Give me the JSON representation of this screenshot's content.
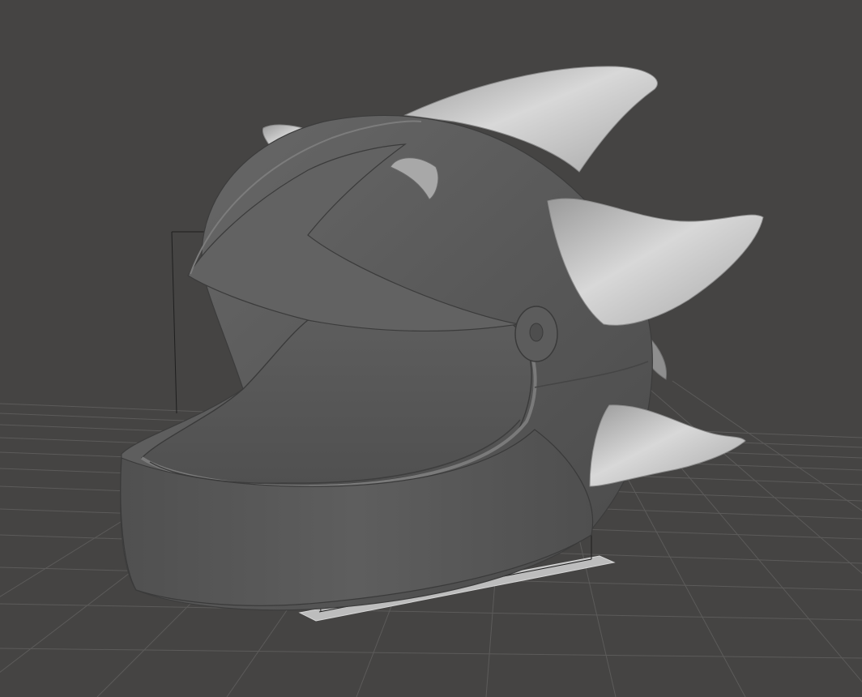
{
  "viewport": {
    "kind": "3d-model-viewport",
    "background_color": "#454443",
    "grid_color": "#5c5b5a",
    "model": {
      "description_icon": "spiked-motorcycle-helmet-model",
      "shell_color": "#5a5a5a",
      "spike_color": "#cfcfcf",
      "bounding_box_visible": true,
      "build_plate_visible": true
    }
  }
}
